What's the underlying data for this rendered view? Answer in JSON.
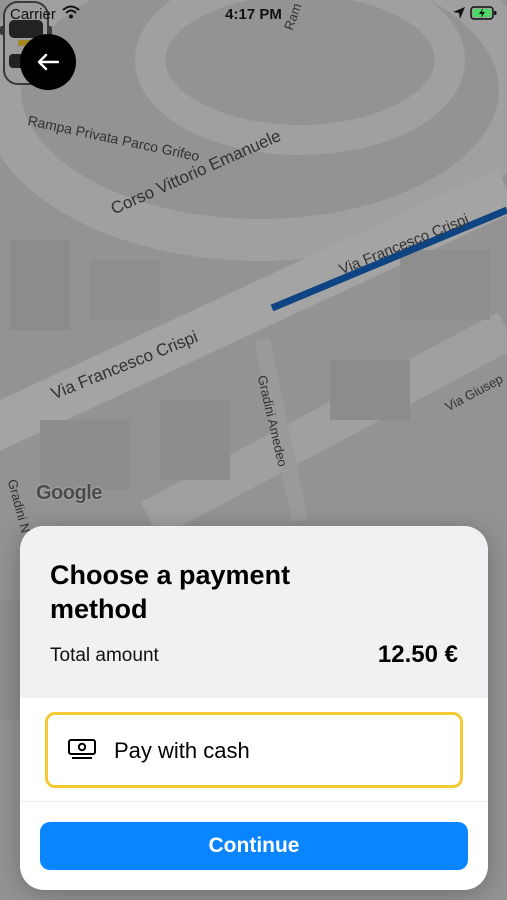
{
  "status_bar": {
    "carrier": "Carrier",
    "time": "4:17 PM",
    "icons": [
      "wifi-icon",
      "location-arrow-icon",
      "battery-charging-icon"
    ]
  },
  "map": {
    "streets": [
      "Rampa Privata Parco Grifeo",
      "Corso Vittorio Emanuele",
      "Via Francesco Crispi",
      "Via Francesco Crispi",
      "Gradini Amedeo",
      "Via Giusep",
      "Gradini N",
      "Ram"
    ],
    "attribution": "Google",
    "route_color": "#1565c0"
  },
  "back_button": {
    "icon": "arrow-left-icon"
  },
  "payment_sheet": {
    "title": "Choose a payment method",
    "total_label": "Total amount",
    "total_value": "12.50 €",
    "options": [
      {
        "label": "Pay with cash",
        "icon": "cash-icon",
        "selected": true
      }
    ],
    "continue_label": "Continue"
  },
  "colors": {
    "accent": "#0a84ff",
    "selected_border": "#f3c934",
    "header_bg": "#f1f1f4"
  }
}
